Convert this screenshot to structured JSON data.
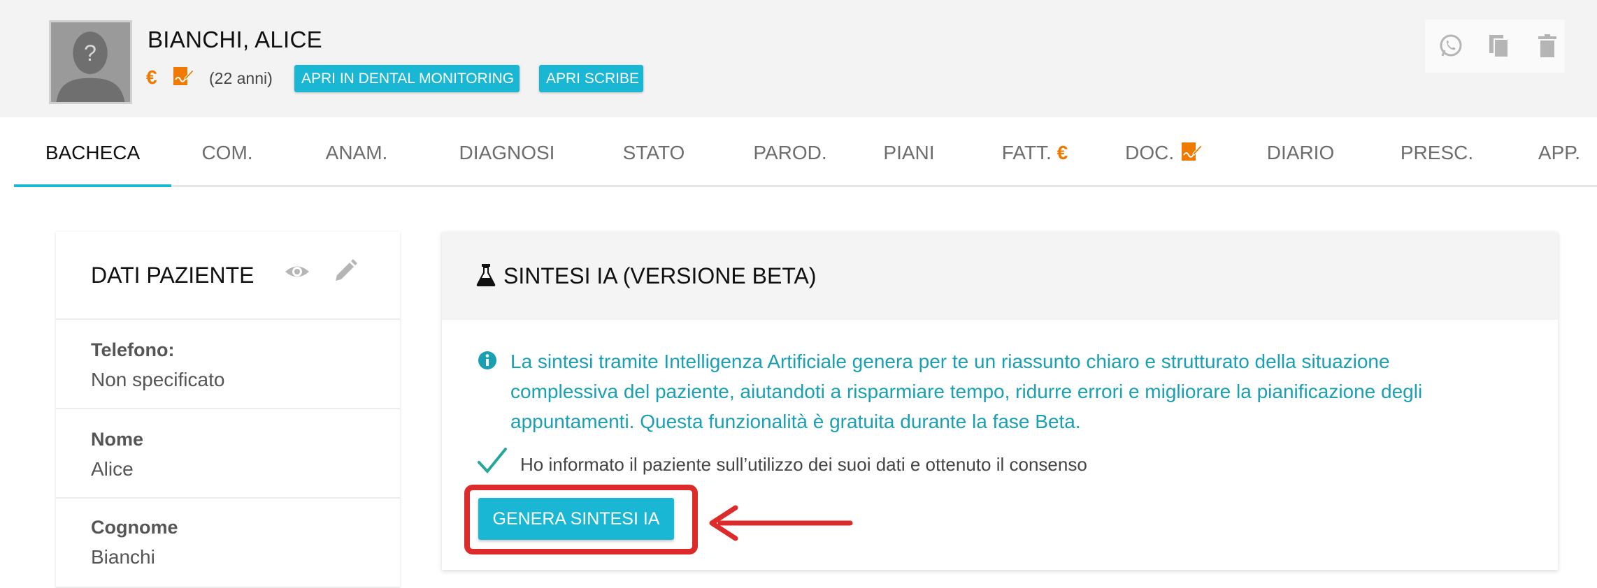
{
  "header": {
    "patient_name": "BIANCHI, ALICE",
    "euro_symbol": "€",
    "age": "(22 anni)",
    "btn_dental": "APRI IN DENTAL MONITORING",
    "btn_scribe": "APRI SCRIBE",
    "avatar_symbol": "?",
    "actions": [
      "whatsapp-icon",
      "copy-icon",
      "trash-icon"
    ]
  },
  "tabs": [
    {
      "label": "BACHECA",
      "active": true
    },
    {
      "label": "COM."
    },
    {
      "label": "ANAM."
    },
    {
      "label": "DIAGNOSI"
    },
    {
      "label": "STATO"
    },
    {
      "label": "PAROD."
    },
    {
      "label": "PIANI"
    },
    {
      "label": "FATT.",
      "suffix": "€"
    },
    {
      "label": "DOC."
    },
    {
      "label": "DIARIO"
    },
    {
      "label": "PRESC."
    },
    {
      "label": "APP."
    }
  ],
  "patient_card": {
    "title": "DATI PAZIENTE",
    "fields": [
      {
        "label": "Telefono:",
        "value": "Non specificato"
      },
      {
        "label": "Nome",
        "value": "Alice"
      },
      {
        "label": "Cognome",
        "value": "Bianchi"
      }
    ]
  },
  "ai_card": {
    "title": "SINTESI IA (VERSIONE BETA)",
    "info_line1": "La sintesi tramite Intelligenza Artificiale genera per te un riassunto chiaro e strutturato della situazione",
    "info_line2": "complessiva del paziente, aiutandoti a risparmiare tempo, ridurre errori e migliorare la pianificazione degli",
    "info_line3": "appuntamenti. Questa funzionalità è gratuita durante la fase Beta.",
    "consent": "Ho informato il paziente sull’utilizzo dei suoi dati e ottenuto il consenso",
    "consent_checked": true,
    "generate_label": "GENERA SINTESI IA"
  },
  "colors": {
    "accent": "#19b7d3",
    "orange": "#f07a00",
    "info_text": "#1aa0b2",
    "annotation_red": "#dd2a2a"
  }
}
